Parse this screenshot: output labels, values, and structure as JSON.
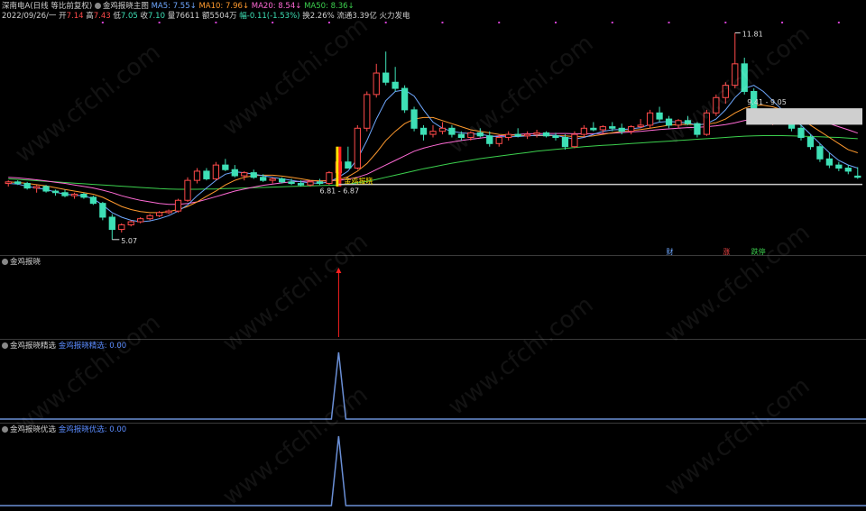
{
  "header": {
    "stock_name": "深南电A(日线 等比前复权)",
    "indicator_main": "金鸡报晓主图",
    "ma5": "MA5: 7.55",
    "ma10": "MA10: 7.96",
    "ma20": "MA20: 8.54",
    "ma50": "MA50: 8.36",
    "arrow_down": "↓",
    "line2": {
      "date": "2022/09/26/一",
      "open_label": "开",
      "open": "7.14",
      "high_label": "高",
      "high": "7.43",
      "low_label": "低",
      "low": "7.05",
      "close_label": "收",
      "close": "7.10",
      "volume": "量76611",
      "amount": "额5504万",
      "change": "幅-0.11(-1.53%)",
      "turnover": "换2.26%",
      "float_cap": "流通3.39亿",
      "sector": "火力发电"
    }
  },
  "annotations": {
    "high_label": "11.81",
    "low_label": "5.07",
    "range1": "6.81 - 6.87",
    "range2": "9.41 - 9.05",
    "signal_label": "金鸡报晓",
    "badges": [
      "财",
      "涨",
      "跌停"
    ]
  },
  "panels": [
    {
      "title": "金鸡报晓",
      "value": ""
    },
    {
      "title": "金鸡报晓精选",
      "series_label": "金鸡报晓精选: 0.00"
    },
    {
      "title": "金鸡报晓优选",
      "series_label": "金鸡报晓优选: 0.00"
    }
  ],
  "watermark": "www.cfchi.com",
  "colors": {
    "up": "#ff4a4a",
    "down": "#3ee0b6",
    "ma5": "#6fa8ff",
    "ma10": "#ff9a2e",
    "ma20": "#ff6ad5",
    "ma50": "#3cd04e",
    "signal": "#ffe000",
    "indicator_line": "#6a8fd6"
  },
  "chart_data": {
    "type": "candlestick",
    "price_range": [
      4.8,
      12.0
    ],
    "candles": [
      [
        6.9,
        7.0,
        6.8,
        6.95
      ],
      [
        6.95,
        7.0,
        6.85,
        6.9
      ],
      [
        6.9,
        6.95,
        6.7,
        6.75
      ],
      [
        6.75,
        6.85,
        6.6,
        6.8
      ],
      [
        6.8,
        6.85,
        6.6,
        6.65
      ],
      [
        6.65,
        6.7,
        6.5,
        6.6
      ],
      [
        6.6,
        6.7,
        6.45,
        6.5
      ],
      [
        6.5,
        6.6,
        6.4,
        6.55
      ],
      [
        6.55,
        6.6,
        6.4,
        6.45
      ],
      [
        6.45,
        6.5,
        6.2,
        6.25
      ],
      [
        6.25,
        6.3,
        5.7,
        5.8
      ],
      [
        5.8,
        5.9,
        5.07,
        5.4
      ],
      [
        5.4,
        5.6,
        5.3,
        5.55
      ],
      [
        5.55,
        5.7,
        5.5,
        5.65
      ],
      [
        5.65,
        5.8,
        5.6,
        5.75
      ],
      [
        5.75,
        5.9,
        5.7,
        5.85
      ],
      [
        5.85,
        6.0,
        5.8,
        5.95
      ],
      [
        5.95,
        6.05,
        5.9,
        6.0
      ],
      [
        6.0,
        6.4,
        5.95,
        6.35
      ],
      [
        6.35,
        7.1,
        6.3,
        7.0
      ],
      [
        7.0,
        7.4,
        6.9,
        7.3
      ],
      [
        7.3,
        7.4,
        7.0,
        7.05
      ],
      [
        7.05,
        7.6,
        7.0,
        7.5
      ],
      [
        7.5,
        7.7,
        7.3,
        7.35
      ],
      [
        7.35,
        7.5,
        7.1,
        7.15
      ],
      [
        7.15,
        7.3,
        7.0,
        7.25
      ],
      [
        7.25,
        7.35,
        7.05,
        7.1
      ],
      [
        7.1,
        7.2,
        6.95,
        7.0
      ],
      [
        7.0,
        7.1,
        6.9,
        7.05
      ],
      [
        7.05,
        7.1,
        6.9,
        6.95
      ],
      [
        6.95,
        7.05,
        6.85,
        6.9
      ],
      [
        6.9,
        7.0,
        6.8,
        6.85
      ],
      [
        6.85,
        7.0,
        6.8,
        6.95
      ],
      [
        6.95,
        7.05,
        6.85,
        6.9
      ],
      [
        6.9,
        7.3,
        6.85,
        7.25
      ],
      [
        7.25,
        7.9,
        7.2,
        7.6
      ],
      [
        7.6,
        8.1,
        7.5,
        7.4
      ],
      [
        7.4,
        8.8,
        7.35,
        8.7
      ],
      [
        8.7,
        9.9,
        8.6,
        9.8
      ],
      [
        9.8,
        10.8,
        9.7,
        10.5
      ],
      [
        10.5,
        11.2,
        10.1,
        10.2
      ],
      [
        10.2,
        10.7,
        9.9,
        10.0
      ],
      [
        10.0,
        10.1,
        9.2,
        9.3
      ],
      [
        9.3,
        9.4,
        8.6,
        8.7
      ],
      [
        8.7,
        8.8,
        8.3,
        8.5
      ],
      [
        8.5,
        8.8,
        8.4,
        8.6
      ],
      [
        8.6,
        8.9,
        8.5,
        8.7
      ],
      [
        8.7,
        8.8,
        8.4,
        8.5
      ],
      [
        8.5,
        8.6,
        8.3,
        8.4
      ],
      [
        8.4,
        8.6,
        8.3,
        8.55
      ],
      [
        8.55,
        8.7,
        8.4,
        8.45
      ],
      [
        8.45,
        8.6,
        8.1,
        8.2
      ],
      [
        8.2,
        8.5,
        8.1,
        8.4
      ],
      [
        8.4,
        8.6,
        8.3,
        8.5
      ],
      [
        8.5,
        8.7,
        8.4,
        8.45
      ],
      [
        8.45,
        8.6,
        8.35,
        8.5
      ],
      [
        8.5,
        8.65,
        8.4,
        8.55
      ],
      [
        8.55,
        8.6,
        8.4,
        8.45
      ],
      [
        8.45,
        8.55,
        8.3,
        8.4
      ],
      [
        8.4,
        8.5,
        8.0,
        8.1
      ],
      [
        8.1,
        8.6,
        8.05,
        8.5
      ],
      [
        8.5,
        8.8,
        8.4,
        8.7
      ],
      [
        8.7,
        8.9,
        8.6,
        8.65
      ],
      [
        8.65,
        8.8,
        8.55,
        8.75
      ],
      [
        8.75,
        8.9,
        8.6,
        8.7
      ],
      [
        8.7,
        8.85,
        8.5,
        8.6
      ],
      [
        8.6,
        8.8,
        8.5,
        8.75
      ],
      [
        8.75,
        9.0,
        8.7,
        8.8
      ],
      [
        8.8,
        9.3,
        8.7,
        9.2
      ],
      [
        9.2,
        9.4,
        8.9,
        9.0
      ],
      [
        9.0,
        9.1,
        8.7,
        8.8
      ],
      [
        8.8,
        9.0,
        8.7,
        8.95
      ],
      [
        8.95,
        9.1,
        8.8,
        8.85
      ],
      [
        8.85,
        8.9,
        8.4,
        8.5
      ],
      [
        8.5,
        9.3,
        8.45,
        9.2
      ],
      [
        9.2,
        9.8,
        9.1,
        9.7
      ],
      [
        9.7,
        10.2,
        9.5,
        10.1
      ],
      [
        10.1,
        11.81,
        10.0,
        10.8
      ],
      [
        10.8,
        11.0,
        9.8,
        9.9
      ],
      [
        9.9,
        10.0,
        9.1,
        9.2
      ],
      [
        9.2,
        9.3,
        8.9,
        9.0
      ],
      [
        9.0,
        9.2,
        8.8,
        9.1
      ],
      [
        9.1,
        9.2,
        8.9,
        8.95
      ],
      [
        8.95,
        9.0,
        8.6,
        8.7
      ],
      [
        8.7,
        8.8,
        8.3,
        8.4
      ],
      [
        8.4,
        8.5,
        8.0,
        8.1
      ],
      [
        8.1,
        8.2,
        7.6,
        7.7
      ],
      [
        7.7,
        7.9,
        7.4,
        7.5
      ],
      [
        7.5,
        7.6,
        7.3,
        7.4
      ],
      [
        7.4,
        7.5,
        7.2,
        7.3
      ],
      [
        7.14,
        7.43,
        7.05,
        7.1
      ]
    ],
    "ma5": [
      6.9,
      6.88,
      6.8,
      6.75,
      6.7,
      6.62,
      6.55,
      6.52,
      6.5,
      6.4,
      6.2,
      5.95,
      5.8,
      5.7,
      5.65,
      5.68,
      5.75,
      5.85,
      6.0,
      6.2,
      6.5,
      6.75,
      7.0,
      7.2,
      7.28,
      7.25,
      7.2,
      7.15,
      7.1,
      7.05,
      7.0,
      6.95,
      6.92,
      6.9,
      6.95,
      7.1,
      7.3,
      7.7,
      8.3,
      9.0,
      9.6,
      9.9,
      9.95,
      9.75,
      9.3,
      8.9,
      8.7,
      8.6,
      8.55,
      8.52,
      8.5,
      8.45,
      8.42,
      8.42,
      8.43,
      8.45,
      8.47,
      8.48,
      8.47,
      8.4,
      8.35,
      8.4,
      8.5,
      8.6,
      8.65,
      8.66,
      8.68,
      8.72,
      8.82,
      8.9,
      8.92,
      8.9,
      8.88,
      8.8,
      8.85,
      9.0,
      9.3,
      9.7,
      10.0,
      10.1,
      9.9,
      9.6,
      9.3,
      9.0,
      8.8,
      8.5,
      8.2,
      7.9,
      7.65,
      7.5,
      7.4
    ],
    "ma10": [
      6.95,
      6.93,
      6.9,
      6.86,
      6.82,
      6.76,
      6.7,
      6.65,
      6.6,
      6.55,
      6.45,
      6.3,
      6.15,
      6.05,
      5.98,
      5.95,
      5.95,
      5.98,
      6.05,
      6.15,
      6.3,
      6.48,
      6.65,
      6.85,
      7.0,
      7.1,
      7.15,
      7.17,
      7.17,
      7.14,
      7.1,
      7.05,
      7.0,
      6.98,
      6.98,
      7.02,
      7.12,
      7.3,
      7.55,
      7.9,
      8.3,
      8.6,
      8.85,
      9.0,
      9.05,
      9.05,
      8.95,
      8.85,
      8.75,
      8.65,
      8.6,
      8.55,
      8.5,
      8.48,
      8.47,
      8.46,
      8.46,
      8.46,
      8.46,
      8.45,
      8.43,
      8.42,
      8.45,
      8.5,
      8.55,
      8.6,
      8.63,
      8.66,
      8.7,
      8.75,
      8.8,
      8.82,
      8.83,
      8.82,
      8.83,
      8.88,
      9.0,
      9.2,
      9.35,
      9.45,
      9.45,
      9.4,
      9.3,
      9.15,
      9.0,
      8.8,
      8.6,
      8.4,
      8.2,
      8.0,
      7.9
    ],
    "ma20": [
      7.1,
      7.08,
      7.05,
      7.02,
      6.98,
      6.94,
      6.9,
      6.85,
      6.8,
      6.75,
      6.68,
      6.6,
      6.5,
      6.42,
      6.35,
      6.3,
      6.25,
      6.22,
      6.22,
      6.25,
      6.3,
      6.38,
      6.47,
      6.56,
      6.65,
      6.72,
      6.78,
      6.84,
      6.88,
      6.92,
      6.95,
      6.97,
      6.98,
      6.98,
      6.99,
      7.0,
      7.04,
      7.1,
      7.2,
      7.35,
      7.5,
      7.65,
      7.8,
      7.95,
      8.05,
      8.13,
      8.2,
      8.25,
      8.3,
      8.34,
      8.38,
      8.42,
      8.45,
      8.48,
      8.5,
      8.52,
      8.52,
      8.53,
      8.53,
      8.53,
      8.52,
      8.52,
      8.52,
      8.53,
      8.54,
      8.56,
      8.58,
      8.6,
      8.63,
      8.66,
      8.68,
      8.7,
      8.72,
      8.73,
      8.75,
      8.78,
      8.82,
      8.88,
      8.95,
      9.0,
      9.05,
      9.07,
      9.08,
      9.07,
      9.05,
      9.0,
      8.93,
      8.85,
      8.75,
      8.65,
      8.54
    ],
    "ma50": [
      7.05,
      7.03,
      7.01,
      6.99,
      6.97,
      6.95,
      6.93,
      6.91,
      6.89,
      6.87,
      6.85,
      6.83,
      6.81,
      6.79,
      6.77,
      6.75,
      6.73,
      6.72,
      6.71,
      6.71,
      6.71,
      6.72,
      6.72,
      6.73,
      6.74,
      6.75,
      6.76,
      6.77,
      6.78,
      6.79,
      6.8,
      6.81,
      6.82,
      6.83,
      6.84,
      6.85,
      6.88,
      6.92,
      6.97,
      7.03,
      7.1,
      7.17,
      7.24,
      7.31,
      7.38,
      7.44,
      7.5,
      7.56,
      7.61,
      7.66,
      7.71,
      7.75,
      7.79,
      7.83,
      7.87,
      7.91,
      7.95,
      7.98,
      8.01,
      8.04,
      8.07,
      8.1,
      8.12,
      8.14,
      8.16,
      8.18,
      8.2,
      8.22,
      8.24,
      8.26,
      8.28,
      8.3,
      8.32,
      8.34,
      8.36,
      8.38,
      8.4,
      8.42,
      8.44,
      8.45,
      8.46,
      8.46,
      8.46,
      8.45,
      8.44,
      8.43,
      8.42,
      8.41,
      8.4,
      8.38,
      8.36
    ],
    "signal_index": 35,
    "panel2_peak": 1,
    "panel3_peak": 1
  }
}
